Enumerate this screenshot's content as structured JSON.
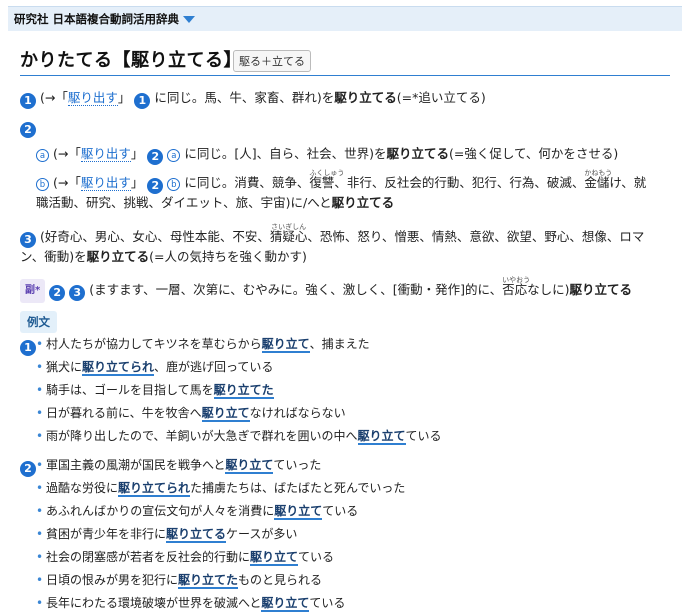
{
  "topbar": {
    "title": "研究社 日本語複合動詞活用辞典"
  },
  "entry": {
    "headword": "かりたてる【駆り立てる】",
    "tag": "駆る＋立てる"
  },
  "sense1": {
    "num": "1",
    "a": "(→「",
    "link": "駆り出す",
    "b": "」",
    "subnum": "1",
    "c": " に同じ。馬、牛、家畜、群れ)を",
    "bold": "駆り立てる",
    "d": "(=*追い立てる)"
  },
  "sense2": {
    "num": "2"
  },
  "sense2a": {
    "sub": "a",
    "a": "(→「",
    "link": "駆り出す",
    "b": "」",
    "n": "2",
    "s": "a",
    "c": " に同じ。[人]、自ら、社会、世界)を",
    "bold": "駆り立てる",
    "d": "(=強く促して、何かをさせる)"
  },
  "sense2b": {
    "sub": "b",
    "a": "(→「",
    "link": "駆り出す",
    "b": "」",
    "n": "2",
    "s": "b",
    "c": " に同じ。消費、競争、",
    "k1": "復讐",
    "r1": "ふくしゅう",
    "c2": "、非行、反社会的行動、犯行、行為、破滅、",
    "k2": "金儲",
    "r2": "かねもう",
    "c3": "け、就",
    "line2": "職活動、研究、挑戦、ダイエット、旅、宇宙)に/へと",
    "bold": "駆り立てる"
  },
  "sense3": {
    "num": "3",
    "a": "(好奇心、男心、女心、母性本能、不安、",
    "k": "猜疑心",
    "r": "さいぎしん",
    "b": "、恐怖、怒り、憎悪、情熱、意欲、欲望、野心、想像、ロマ",
    "line2a": "ン、衝動)を",
    "bold": "駆り立てる",
    "line2b": "(=人の気持ちを強く動かす)"
  },
  "adverb": {
    "badge": "副*",
    "n1": "2",
    "n2": "3",
    "a": "(ますます、一層、次第に、むやみに。強く、激しく、[衝動・発作]的に、",
    "k": "否応",
    "r": "いやおう",
    "b": "なしに)",
    "bold": "駆り立てる"
  },
  "examples_label": "例文",
  "ex_group1": {
    "num": "1"
  },
  "ex_group2": {
    "num": "2"
  },
  "examples": [
    {
      "pre": "村人たちが協力してキツネを草むらから",
      "u": "駆り立て",
      "post": "、捕まえた"
    },
    {
      "pre": "猟犬に",
      "u": "駆り立てられ",
      "post": "、鹿が逃げ回っている"
    },
    {
      "pre": "騎手は、ゴールを目指して馬を",
      "u": "駆り立てた",
      "post": ""
    },
    {
      "pre": "日が暮れる前に、牛を牧舎へ",
      "u": "駆り立て",
      "post": "なければならない"
    },
    {
      "pre": "雨が降り出したので、羊飼いが大急ぎで群れを囲いの中へ",
      "u": "駆り立て",
      "post": "ている"
    },
    {
      "pre": "軍国主義の風潮が国民を戦争へと",
      "u": "駆り立て",
      "post": "ていった"
    },
    {
      "pre": "過酷な労役に",
      "u": "駆り立てられ",
      "post": "た捕虜たちは、ばたばたと死んでいった"
    },
    {
      "pre": "あふれんばかりの宣伝文句が人々を消費に",
      "u": "駆り立て",
      "post": "ている"
    },
    {
      "pre": "貧困が青少年を非行に",
      "u": "駆り立てる",
      "post": "ケースが多い"
    },
    {
      "pre": "社会の閉塞感が若者を反社会的行動に",
      "u": "駆り立て",
      "post": "ている"
    },
    {
      "pre": "日頃の恨みが男を犯行に",
      "u": "駆り立てた",
      "post": "ものと見られる"
    },
    {
      "pre": "長年にわたる環境破壊が世界を破滅へと",
      "u": "駆り立て",
      "post": "ている"
    }
  ]
}
